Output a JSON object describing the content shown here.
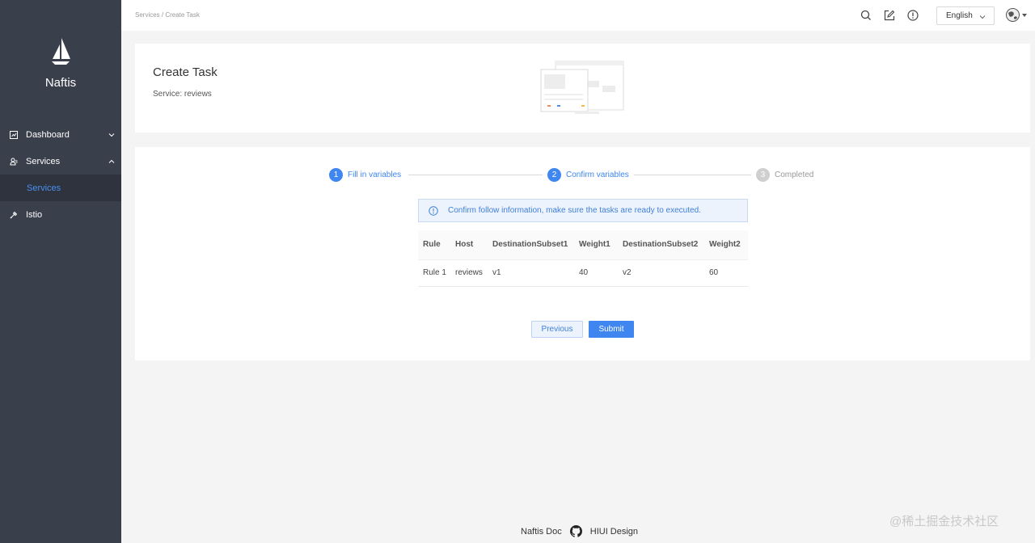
{
  "sidebar": {
    "logo_text": "Naftis",
    "items": [
      {
        "label": "Dashboard",
        "icon": "dashboard-icon",
        "chevron": "down"
      },
      {
        "label": "Services",
        "icon": "services-icon",
        "chevron": "up"
      },
      {
        "label": "Istio",
        "icon": "istio-icon"
      }
    ],
    "submenu": [
      {
        "label": "Services"
      }
    ]
  },
  "header": {
    "breadcrumb": "Services / Create Task",
    "icons": [
      "search-icon",
      "edit-icon",
      "info-icon"
    ],
    "language": "English"
  },
  "title_card": {
    "title": "Create Task",
    "subtitle": "Service: reviews"
  },
  "steps": [
    {
      "number": "1",
      "label": "Fill in variables",
      "state": "done"
    },
    {
      "number": "2",
      "label": "Confirm variables",
      "state": "active"
    },
    {
      "number": "3",
      "label": "Completed",
      "state": "pending"
    }
  ],
  "alert": {
    "text": "Confirm follow information, make sure the tasks are ready to executed."
  },
  "table": {
    "headers": [
      "Rule",
      "Host",
      "DestinationSubset1",
      "Weight1",
      "DestinationSubset2",
      "Weight2"
    ],
    "rows": [
      [
        "Rule 1",
        "reviews",
        "v1",
        "40",
        "v2",
        "60"
      ]
    ]
  },
  "buttons": {
    "previous": "Previous",
    "submit": "Submit"
  },
  "footer": {
    "doc": "Naftis Doc",
    "design": "HIUI Design"
  },
  "watermark": "@稀土掘金技术社区",
  "colors": {
    "sidebar_bg": "#393f4b",
    "accent": "#3f86f0",
    "step_pending": "#cfcfcf"
  }
}
